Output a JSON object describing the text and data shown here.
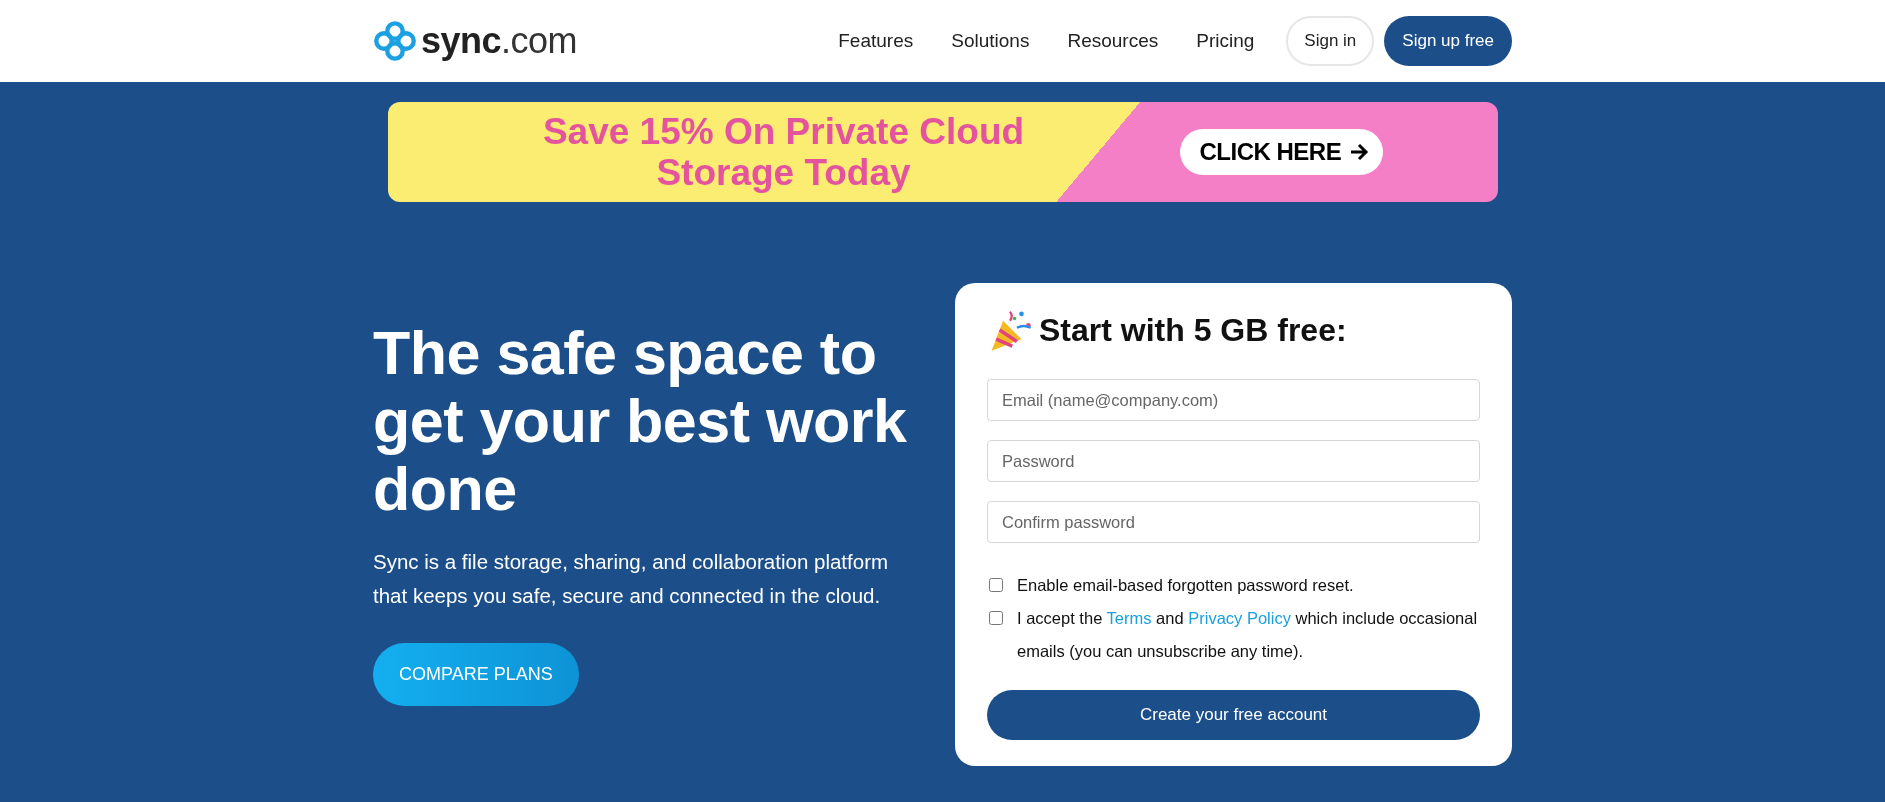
{
  "header": {
    "logo": {
      "name": "sync",
      "suffix": ".com"
    },
    "nav": [
      {
        "label": "Features"
      },
      {
        "label": "Solutions"
      },
      {
        "label": "Resources"
      },
      {
        "label": "Pricing"
      }
    ],
    "sign_in": "Sign in",
    "sign_up": "Sign up free"
  },
  "banner": {
    "lines": [
      "Save 15% On Private Cloud",
      "Storage Today"
    ],
    "button": "CLICK HERE"
  },
  "hero": {
    "headline": "The safe space to get your best work done",
    "text": "Sync is a file storage, sharing, and collaboration platform that keeps you safe, secure and connected in the cloud.",
    "button": "COMPARE PLANS"
  },
  "signup": {
    "title": "Start with 5 GB free:",
    "fields": [
      {
        "placeholder": "Email (name@company.com)"
      },
      {
        "placeholder": "Password"
      },
      {
        "placeholder": "Confirm password"
      }
    ],
    "checkboxes": [
      {
        "checked": false,
        "parts": [
          {
            "kind": "text",
            "text": "Enable email-based forgotten password reset."
          }
        ]
      },
      {
        "checked": false,
        "parts": [
          {
            "kind": "text",
            "text": "I accept the "
          },
          {
            "kind": "link",
            "text": "Terms"
          },
          {
            "kind": "text",
            "text": " and "
          },
          {
            "kind": "link",
            "text": "Privacy Policy"
          },
          {
            "kind": "text",
            "text": " which include occasional emails (you can unsubscribe any time)."
          }
        ]
      }
    ],
    "button": "Create your free account"
  }
}
